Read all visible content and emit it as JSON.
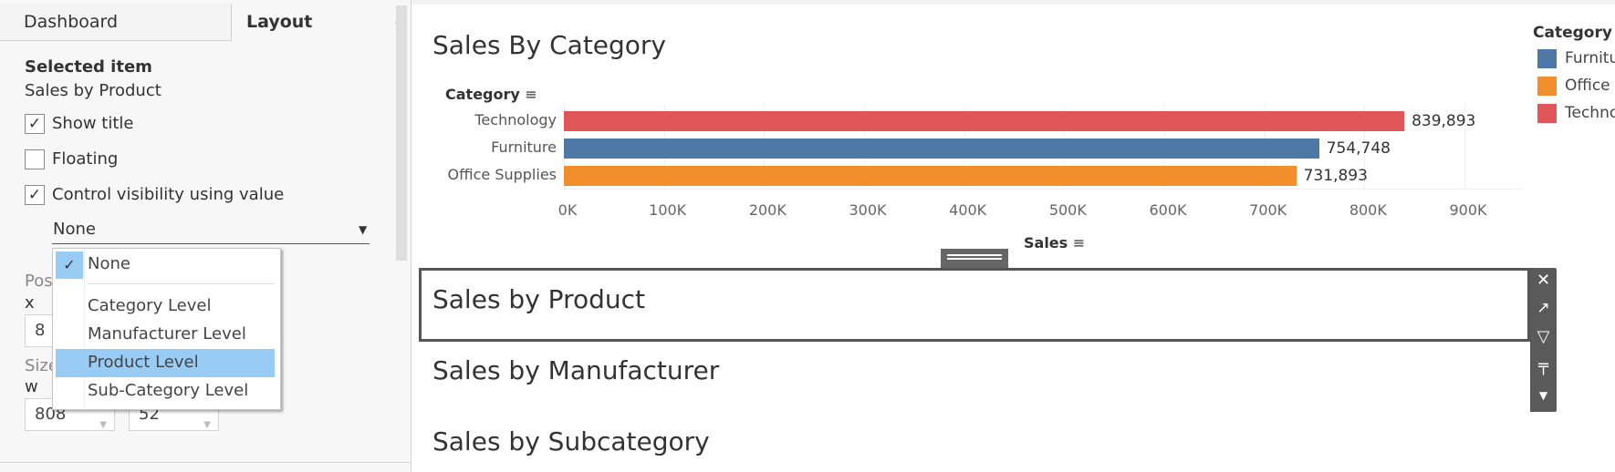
{
  "panel": {
    "tabs": [
      "Dashboard",
      "Layout"
    ],
    "active_tab": "Layout",
    "selected_item_heading": "Selected item",
    "selected_item_name": "Sales by Product",
    "show_title": {
      "label": "Show title",
      "checked": true
    },
    "floating": {
      "label": "Floating",
      "checked": false
    },
    "control_visibility": {
      "label": "Control visibility using value",
      "checked": true
    },
    "visibility_value": "None",
    "dropdown_options": [
      "None",
      "Category Level",
      "Manufacturer Level",
      "Product Level",
      "Sub-Category Level"
    ],
    "dropdown_checked": "None",
    "dropdown_highlighted": "Product Level",
    "position_label": "Pos",
    "x_label": "x",
    "x_value": "8",
    "size_label": "Size",
    "w_label": "w",
    "w_value": "808",
    "h_value": "52"
  },
  "dashboard": {
    "titles": [
      "Sales By Category",
      "Sales by Product",
      "Sales by Manufacturer",
      "Sales by Subcategory"
    ],
    "selected_title": "Sales by Product"
  },
  "chart_data": {
    "type": "bar",
    "orientation": "horizontal",
    "title": "Sales By Category",
    "ylabel": "Category",
    "xlabel": "Sales",
    "categories": [
      "Technology",
      "Furniture",
      "Office Supplies"
    ],
    "values": [
      839893,
      754748,
      731893
    ],
    "value_labels": [
      "839,893",
      "754,748",
      "731,893"
    ],
    "colors": [
      "#e15759",
      "#4e79a7",
      "#f28e2b"
    ],
    "xlim": [
      0,
      900000
    ],
    "ticks": [
      "0K",
      "100K",
      "200K",
      "300K",
      "400K",
      "500K",
      "600K",
      "700K",
      "800K",
      "900K"
    ],
    "grid": true
  },
  "legend": {
    "title": "Category",
    "items": [
      {
        "label": "Furniture",
        "color": "#4e79a7"
      },
      {
        "label": "Office Supplies",
        "color": "#f28e2b"
      },
      {
        "label": "Technology",
        "color": "#e15759"
      }
    ]
  },
  "toolbar_icons": [
    "close-icon",
    "open-icon",
    "filter-icon",
    "pin-icon",
    "more-icon"
  ]
}
